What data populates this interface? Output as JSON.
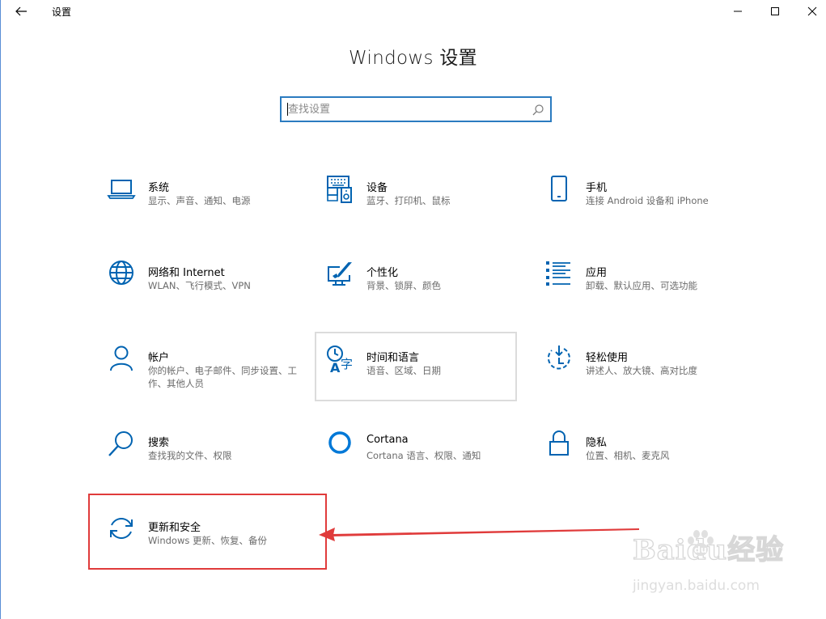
{
  "window": {
    "title": "设置",
    "controls": {
      "minimize": "minimize-icon",
      "maximize": "maximize-icon",
      "close": "close-icon"
    }
  },
  "page": {
    "heading": "Windows 设置"
  },
  "search": {
    "placeholder": "查找设置",
    "value": ""
  },
  "categories": [
    {
      "name": "系统",
      "desc": "显示、声音、通知、电源",
      "icon": "laptop-icon"
    },
    {
      "name": "设备",
      "desc": "蓝牙、打印机、鼠标",
      "icon": "keyboard-speaker-icon"
    },
    {
      "name": "手机",
      "desc": "连接 Android 设备和 iPhone",
      "icon": "phone-icon"
    },
    {
      "name": "网络和 Internet",
      "desc": "WLAN、飞行模式、VPN",
      "icon": "globe-icon"
    },
    {
      "name": "个性化",
      "desc": "背景、锁屏、颜色",
      "icon": "paint-monitor-icon"
    },
    {
      "name": "应用",
      "desc": "卸载、默认应用、可选功能",
      "icon": "apps-list-icon"
    },
    {
      "name": "帐户",
      "desc": "你的帐户、电子邮件、同步设置、工作、其他人员",
      "icon": "person-icon"
    },
    {
      "name": "时间和语言",
      "desc": "语音、区域、日期",
      "icon": "time-language-icon"
    },
    {
      "name": "轻松使用",
      "desc": "讲述人、放大镜、高对比度",
      "icon": "ease-of-access-icon"
    },
    {
      "name": "搜索",
      "desc": "查找我的文件、权限",
      "icon": "magnifier-icon"
    },
    {
      "name": "Cortana",
      "desc": "Cortana 语言、权限、通知",
      "icon": "cortana-ring-icon"
    },
    {
      "name": "隐私",
      "desc": "位置、相机、麦克风",
      "icon": "lock-icon"
    },
    {
      "name": "更新和安全",
      "desc": "Windows 更新、恢复、备份",
      "icon": "sync-arrows-icon"
    }
  ],
  "annotation": {
    "highlight_color": "#e03b3b"
  },
  "colors": {
    "accent": "#0063b1",
    "search_border": "#2b7bc0"
  },
  "watermark": {
    "logo_text": "Baidu经验",
    "url": "jingyan.baidu.com"
  }
}
